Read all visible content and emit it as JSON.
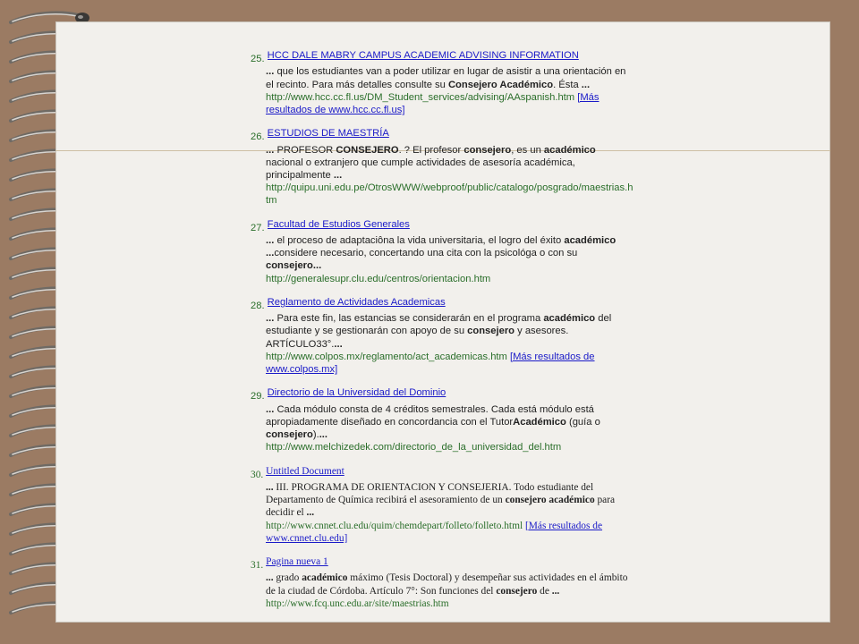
{
  "results": [
    {
      "number": "25.",
      "title": "HCC DALE MABRY CAMPUS ACADEMIC ADVISING INFORMATION",
      "snippet_parts": [
        {
          "t": "... ",
          "b": true
        },
        {
          "t": "que los estudiantes van a poder utilizar en lugar de asistir a una orientación en el recinto.  Para más detalles consulte su  "
        },
        {
          "t": "Consejero Académico",
          "b": true
        },
        {
          "t": ".  Ésta "
        },
        {
          "t": "...",
          "b": true
        }
      ],
      "url": "http://www.hcc.cc.fl.us/DM_Student_services/advising/AAspanish.htm",
      "more": "[Más resultados de www.hcc.cc.fl.us]",
      "serif": false
    },
    {
      "number": "26.",
      "title": "ESTUDIOS DE MAESTRÍA",
      "snippet_parts": [
        {
          "t": "... ",
          "b": true
        },
        {
          "t": "PROFESOR "
        },
        {
          "t": "CONSEJERO",
          "b": true
        },
        {
          "t": ". ? El profesor "
        },
        {
          "t": "consejero",
          "b": true
        },
        {
          "t": ", es un "
        },
        {
          "t": "académico",
          "b": true
        },
        {
          "t": " nacional o extranjero que cumple actividades de asesoría académica, principalmente "
        },
        {
          "t": "...",
          "b": true
        }
      ],
      "url": "http://quipu.uni.edu.pe/OtrosWWW/webproof/public/catalogo/posgrado/maestrias.htm",
      "more": "",
      "serif": false
    },
    {
      "number": "27.",
      "title": "Facultad de Estudios Generales",
      "snippet_parts": [
        {
          "t": "... ",
          "b": true
        },
        {
          "t": "el proceso de adaptaciôna la vida universitaria, el logro del éxito "
        },
        {
          "t": "académico",
          "b": true
        },
        {
          "t": " "
        },
        {
          "t": "...",
          "b": true
        },
        {
          "t": "considere necesario, concertando una cita con la psicológa o con su "
        },
        {
          "t": "consejero",
          "b": true
        },
        {
          "t": "...",
          "b": true
        }
      ],
      "url": "http://generalesupr.clu.edu/centros/orientacion.htm",
      "more": "",
      "serif": false
    },
    {
      "number": "28.",
      "title": "Reglamento de Actividades Academicas",
      "snippet_parts": [
        {
          "t": "... ",
          "b": true
        },
        {
          "t": "Para este fin, las estancias se considerarán en el programa "
        },
        {
          "t": "académico",
          "b": true
        },
        {
          "t": " del estudiante y se gestionarán con apoyo de su "
        },
        {
          "t": "consejero",
          "b": true
        },
        {
          "t": " y asesores. ARTÍCULO33°."
        },
        {
          "t": "...",
          "b": true
        }
      ],
      "url": "http://www.colpos.mx/reglamento/act_academicas.htm",
      "more": "[Más resultados de www.colpos.mx]",
      "serif": false
    },
    {
      "number": "29.",
      "title": " Directorio de la Universidad del Dominio",
      "snippet_parts": [
        {
          "t": "... ",
          "b": true
        },
        {
          "t": "Cada módulo consta de 4 créditos semestrales. Cada está módulo está apropiadamente diseñado en concordancia con el Tutor"
        },
        {
          "t": "Académico",
          "b": true
        },
        {
          "t": " (guía o "
        },
        {
          "t": "consejero",
          "b": true
        },
        {
          "t": ")."
        },
        {
          "t": "...",
          "b": true
        }
      ],
      "url": "http://www.melchizedek.com/directorio_de_la_universidad_del.htm",
      "more": "",
      "serif": false
    },
    {
      "number": "30.",
      "title": "Untitled Document",
      "snippet_parts": [
        {
          "t": "... ",
          "b": true
        },
        {
          "t": "III. PROGRAMA DE ORIENTACION Y CONSEJERIA. Todo estudiante del Departamento de Química recibirá el asesoramiento de un "
        },
        {
          "t": "consejero académico",
          "b": true
        },
        {
          "t": " para decidir el "
        },
        {
          "t": "...",
          "b": true
        }
      ],
      "url": "http://www.cnnet.clu.edu/quim/chemdepart/folleto/folleto.html",
      "more": "[Más resultados de www.cnnet.clu.edu]",
      "serif": true
    },
    {
      "number": "31.",
      "title": "Pagina nueva 1",
      "snippet_parts": [
        {
          "t": "... ",
          "b": true
        },
        {
          "t": "grado "
        },
        {
          "t": "académico",
          "b": true
        },
        {
          "t": " máximo (Tesis Doctoral) y desempeñar sus actividades en el ámbito de la ciudad de Córdoba. Artículo 7°: Son funciones del "
        },
        {
          "t": "consejero",
          "b": true
        },
        {
          "t": " de "
        },
        {
          "t": "...",
          "b": true
        }
      ],
      "url": "http://www.fcq.unc.edu.ar/site/maestrias.htm",
      "more": "",
      "serif": true
    }
  ]
}
